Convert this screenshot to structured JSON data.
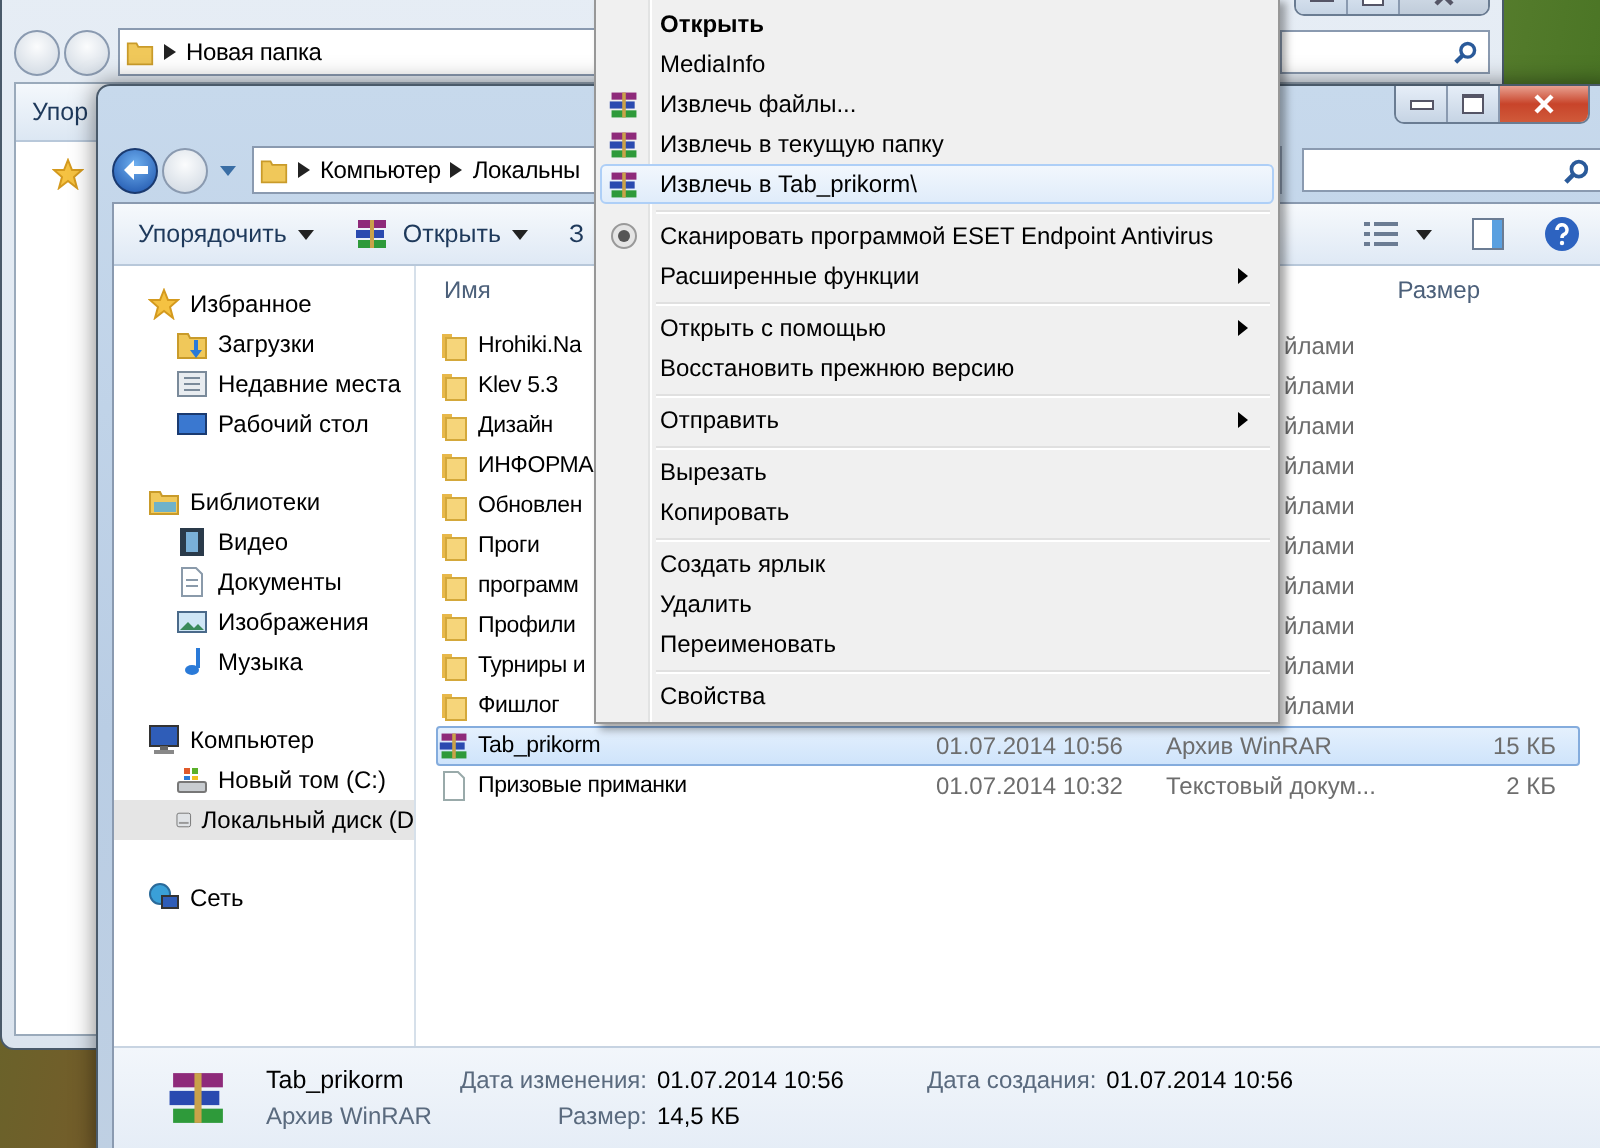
{
  "back_window": {
    "address": "Новая папка",
    "toolbar_item": "Упор"
  },
  "window": {
    "address": [
      "Компьютер",
      "Локальны"
    ],
    "toolbar": [
      {
        "label": "Упорядочить",
        "kind": "menu"
      },
      {
        "label": "Открыть",
        "kind": "archive"
      },
      {
        "label": "З",
        "kind": "plain"
      }
    ]
  },
  "nav": [
    {
      "label": "Избранное",
      "selected": false,
      "children": [
        {
          "label": "Загрузки",
          "selected": false
        },
        {
          "label": "Недавние места",
          "selected": false
        },
        {
          "label": "Рабочий стол",
          "selected": false
        }
      ]
    },
    {
      "label": "Библиотеки",
      "selected": false,
      "children": [
        {
          "label": "Видео",
          "selected": false
        },
        {
          "label": "Документы",
          "selected": false
        },
        {
          "label": "Изображения",
          "selected": false
        },
        {
          "label": "Музыка",
          "selected": false
        }
      ]
    },
    {
      "label": "Компьютер",
      "selected": false,
      "children": [
        {
          "label": "Новый том (C:)",
          "selected": false
        },
        {
          "label": "Локальный диск (D",
          "selected": true
        }
      ]
    },
    {
      "label": "Сеть",
      "selected": false
    }
  ],
  "columns": [
    {
      "label": "Имя",
      "kind": "name"
    },
    {
      "label": "Размер",
      "kind": "size"
    }
  ],
  "rows": [
    {
      "kind": "folder",
      "name": "Hrohiki.Na",
      "type": "йлами",
      "selected": false
    },
    {
      "kind": "folder",
      "name": "Klev 5.3",
      "type": "йлами",
      "selected": false
    },
    {
      "kind": "folder",
      "name": "Дизайн",
      "type": "йлами",
      "selected": false
    },
    {
      "kind": "folder",
      "name": "ИНФОРМА",
      "type": "йлами",
      "selected": false
    },
    {
      "kind": "folder",
      "name": "Обновлен",
      "type": "йлами",
      "selected": false
    },
    {
      "kind": "folder",
      "name": "Проги",
      "type": "йлами",
      "selected": false
    },
    {
      "kind": "folder",
      "name": "программ",
      "type": "йлами",
      "selected": false
    },
    {
      "kind": "folder",
      "name": "Профили",
      "type": "йлами",
      "selected": false
    },
    {
      "kind": "folder",
      "name": "Турниры и",
      "type": "йлами",
      "selected": false
    },
    {
      "kind": "folder",
      "name": "Фишлог",
      "type": "йлами",
      "selected": false
    },
    {
      "kind": "archive",
      "name": "Tab_prikorm",
      "date": "01.07.2014 10:56",
      "type": "Архив WinRAR",
      "size": "15 КБ",
      "selected": true
    },
    {
      "kind": "text",
      "name": "Призовые приманки",
      "date": "01.07.2014 10:32",
      "type": "Текстовый докум...",
      "size": "2 КБ",
      "selected": false
    }
  ],
  "details": {
    "name": "Tab_prikorm",
    "type": "Архив WinRAR",
    "modified_label": "Дата изменения:",
    "modified": "01.07.2014 10:56",
    "size_label": "Размер:",
    "size": "14,5 КБ",
    "created_label": "Дата создания:",
    "created": "01.07.2014 10:56"
  },
  "context_menu": [
    [
      {
        "label": "Открыть",
        "default": true,
        "kind": "plain",
        "submenu": false,
        "selected": false
      },
      {
        "label": "MediaInfo",
        "default": false,
        "kind": "plain",
        "submenu": false,
        "selected": false
      },
      {
        "label": "Извлечь файлы...",
        "default": false,
        "kind": "archive",
        "submenu": false,
        "selected": false
      },
      {
        "label": "Извлечь в текущую папку",
        "default": false,
        "kind": "archive",
        "submenu": false,
        "selected": false
      },
      {
        "label": "Извлечь в Tab_prikorm\\",
        "default": false,
        "kind": "archive",
        "submenu": false,
        "selected": true
      }
    ],
    [
      {
        "label": "Сканировать программой ESET Endpoint Antivirus",
        "default": false,
        "kind": "scan",
        "submenu": false,
        "selected": false
      },
      {
        "label": "Расширенные функции",
        "default": false,
        "kind": "plain",
        "submenu": true,
        "selected": false
      }
    ],
    [
      {
        "label": "Открыть с помощью",
        "default": false,
        "kind": "plain",
        "submenu": true,
        "selected": false
      },
      {
        "label": "Восстановить прежнюю версию",
        "default": false,
        "kind": "plain",
        "submenu": false,
        "selected": false
      }
    ],
    [
      {
        "label": "Отправить",
        "default": false,
        "kind": "plain",
        "submenu": true,
        "selected": false
      }
    ],
    [
      {
        "label": "Вырезать",
        "default": false,
        "kind": "plain",
        "submenu": false,
        "selected": false
      },
      {
        "label": "Копировать",
        "default": false,
        "kind": "plain",
        "submenu": false,
        "selected": false
      }
    ],
    [
      {
        "label": "Создать ярлык",
        "default": false,
        "kind": "plain",
        "submenu": false,
        "selected": false
      },
      {
        "label": "Удалить",
        "default": false,
        "kind": "plain",
        "submenu": false,
        "selected": false
      },
      {
        "label": "Переименовать",
        "default": false,
        "kind": "plain",
        "submenu": false,
        "selected": false
      }
    ],
    [
      {
        "label": "Свойства",
        "default": false,
        "kind": "plain",
        "submenu": false,
        "selected": false
      }
    ]
  ]
}
